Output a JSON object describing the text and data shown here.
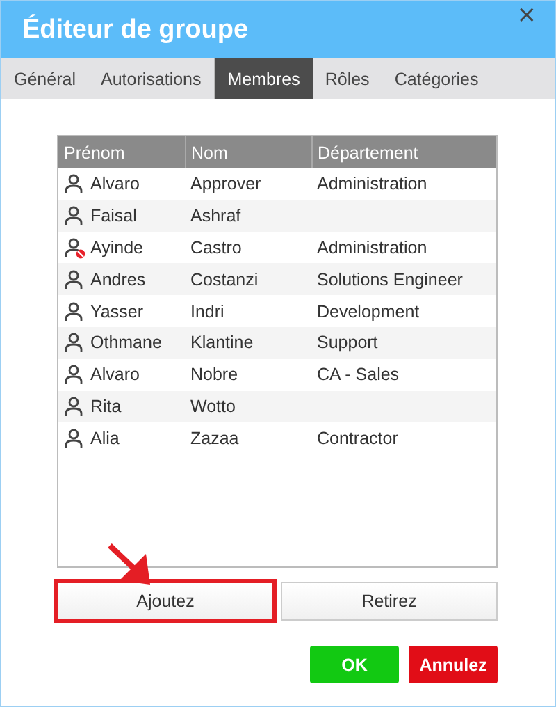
{
  "window": {
    "title": "Éditeur de groupe",
    "close": "×"
  },
  "tabs": [
    {
      "label": "Général",
      "selected": false
    },
    {
      "label": "Autorisations",
      "selected": false
    },
    {
      "label": "Membres",
      "selected": true
    },
    {
      "label": "Rôles",
      "selected": false
    },
    {
      "label": "Catégories",
      "selected": false
    }
  ],
  "table": {
    "columns": [
      "Prénom",
      "Nom",
      "Département"
    ],
    "rows": [
      {
        "first": "Alvaro",
        "last": "Approver",
        "department": "Administration",
        "disabled": false
      },
      {
        "first": "Faisal",
        "last": "Ashraf",
        "department": "",
        "disabled": false
      },
      {
        "first": "Ayinde",
        "last": "Castro",
        "department": "Administration",
        "disabled": true
      },
      {
        "first": "Andres",
        "last": "Costanzi",
        "department": "Solutions Engineer",
        "disabled": false
      },
      {
        "first": "Yasser",
        "last": "Indri",
        "department": "Development",
        "disabled": false
      },
      {
        "first": "Othmane",
        "last": "Klantine",
        "department": "Support",
        "disabled": false
      },
      {
        "first": "Alvaro",
        "last": "Nobre",
        "department": "CA - Sales",
        "disabled": false
      },
      {
        "first": "Rita",
        "last": "Wotto",
        "department": "",
        "disabled": false
      },
      {
        "first": "Alia",
        "last": "Zazaa",
        "department": "Contractor",
        "disabled": false
      }
    ]
  },
  "member_buttons": [
    {
      "label": "Ajoutez",
      "highlighted": true
    },
    {
      "label": "Retirez",
      "highlighted": false
    }
  ],
  "dialog_buttons": [
    {
      "label": "OK",
      "kind": "confirm"
    },
    {
      "label": "Annulez",
      "kind": "cancel"
    }
  ]
}
